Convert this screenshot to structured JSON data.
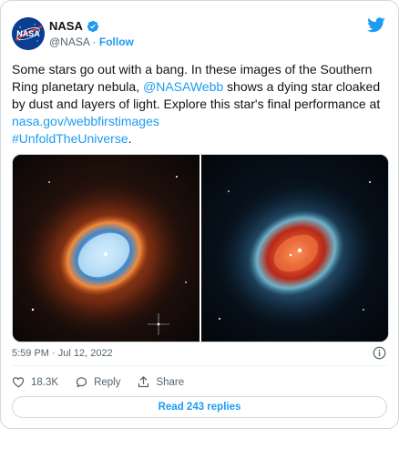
{
  "account": {
    "name": "NASA",
    "handle": "@NASA",
    "separator": "·",
    "follow_label": "Follow",
    "avatar_text": "NASA"
  },
  "tweet": {
    "text_before_mention": "Some stars go out with a bang. In these images of the Southern Ring planetary nebula, ",
    "mention": "@NASAWebb",
    "text_after_mention": " shows a dying star cloaked by dust and layers of light. Explore this star's final performance at ",
    "link": "nasa.gov/webbfirstimages",
    "hashtag": "#UnfoldTheUniverse",
    "hashtag_suffix": "."
  },
  "timestamp": "5:59 PM · Jul 12, 2022",
  "actions": {
    "like_count": "18.3K",
    "reply_label": "Reply",
    "share_label": "Share"
  },
  "read_replies_label": "Read 243 replies",
  "colors": {
    "accent": "#1d9bf0",
    "text": "#0f1419",
    "muted": "#536471",
    "border": "#cfd9de",
    "nasa_blue": "#0b3d91",
    "nasa_red": "#fc3d21"
  },
  "icons": {
    "brand": "twitter-bird-icon",
    "verified": "verified-badge-icon",
    "info": "info-icon",
    "like": "heart-icon",
    "reply": "speech-bubble-icon",
    "share": "share-upload-icon"
  }
}
